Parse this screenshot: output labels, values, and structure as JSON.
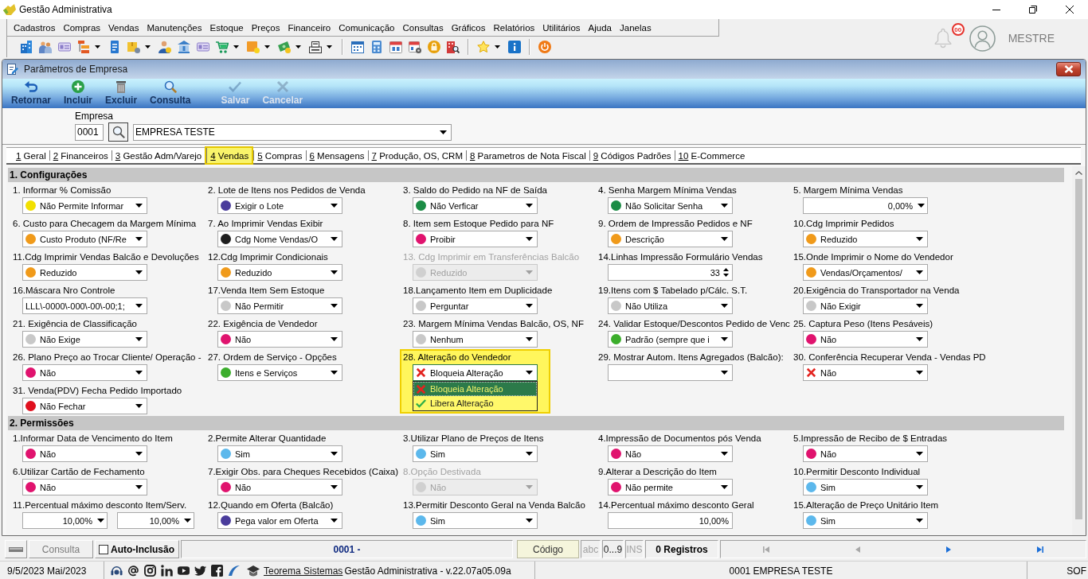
{
  "app": {
    "title": "Gestão Administrativa",
    "notifications": "00",
    "user": "MESTRE"
  },
  "menu": [
    "Cadastros",
    "Compras",
    "Vendas",
    "Manutenções",
    "Estoque",
    "Preços",
    "Financeiro",
    "Comunicação",
    "Consultas",
    "Gráficos",
    "Relatórios",
    "Utilitários",
    "Ajuda",
    "Janelas"
  ],
  "window": {
    "title": "Parâmetros de Empresa"
  },
  "actions": [
    {
      "label": "Retornar",
      "disabled": false
    },
    {
      "label": "Incluir",
      "disabled": false
    },
    {
      "label": "Excluir",
      "disabled": false
    },
    {
      "label": "Consulta",
      "disabled": false
    },
    {
      "label": "Salvar",
      "disabled": true
    },
    {
      "label": "Cancelar",
      "disabled": true
    }
  ],
  "company": {
    "label": "Empresa",
    "code": "0001",
    "name": "EMPRESA TESTE"
  },
  "tabs": [
    {
      "key": "1",
      "label": "Geral",
      "selected": false
    },
    {
      "key": "2",
      "label": "Financeiros",
      "selected": false
    },
    {
      "key": "3",
      "label": "Gestão Adm/Varejo",
      "selected": false
    },
    {
      "key": "4",
      "label": "Vendas",
      "selected": true
    },
    {
      "key": "5",
      "label": "Compras",
      "selected": false
    },
    {
      "key": "6",
      "label": "Mensagens",
      "selected": false
    },
    {
      "key": "7",
      "label": "Produção, OS, CRM",
      "selected": false
    },
    {
      "key": "8",
      "label": "Parametros de Nota Fiscal",
      "selected": false
    },
    {
      "key": "9",
      "label": "Códigos Padrões",
      "selected": false
    },
    {
      "key": "10",
      "label": "E-Commerce",
      "selected": false
    }
  ],
  "sections": [
    {
      "title": "1. Configurações",
      "items": [
        {
          "label": "1. Informar % Comissão",
          "kind": "combo",
          "value": "Não Permite Informar",
          "color": "#f2e000",
          "disabled": false,
          "expanded": false
        },
        {
          "label": "2. Lote de Itens nos Pedidos de Venda",
          "kind": "combo",
          "value": "Exigir o Lote",
          "color": "#4a3c9c",
          "disabled": false,
          "expanded": false
        },
        {
          "label": "3. Saldo do Pedido na NF de Saída",
          "kind": "combo",
          "value": "Não Verficar",
          "color": "#1b8c45",
          "disabled": false,
          "expanded": false
        },
        {
          "label": "4. Senha Margem Mínima Vendas",
          "kind": "combo",
          "value": "Não Solicitar Senha",
          "color": "#1b8c45",
          "disabled": false,
          "expanded": false
        },
        {
          "label": "5. Margem Mínima Vendas",
          "kind": "percent",
          "value": "0,00%",
          "disabled": false,
          "expanded": false
        },
        {
          "label": "6. Custo para Checagem da Margem Mínima",
          "kind": "combo",
          "value": "Custo Produto (NF/Re",
          "color": "#f09a1a",
          "disabled": false,
          "expanded": false
        },
        {
          "label": "7. Ao Imprimir Vendas Exibir",
          "kind": "combo",
          "value": "Cdg Nome Vendas/O",
          "color": "#1e1e1e",
          "disabled": false,
          "expanded": false
        },
        {
          "label": "8. Item sem Estoque Pedido para NF",
          "kind": "combo",
          "value": "Proibir",
          "color": "#e0136e",
          "disabled": false,
          "expanded": false
        },
        {
          "label": "9. Ordem de Impressão Pedidos e NF",
          "kind": "combo",
          "value": "Descrição",
          "color": "#f09a1a",
          "disabled": false,
          "expanded": false
        },
        {
          "label": "10.Cdg Imprimir Pedidos",
          "kind": "combo",
          "value": "Reduzido",
          "color": "#f09a1a",
          "disabled": false,
          "expanded": false
        },
        {
          "label": "11.Cdg Imprimir Vendas Balcão e Devoluções",
          "kind": "combo",
          "value": "Reduzido",
          "color": "#f09a1a",
          "disabled": false,
          "expanded": false
        },
        {
          "label": "12.Cdg Imprimir Condicionais",
          "kind": "combo",
          "value": "Reduzido",
          "color": "#f09a1a",
          "disabled": false,
          "expanded": false
        },
        {
          "label": "13. Cdg Imprimir em Transferências Balcão",
          "kind": "combo",
          "value": "Reduzido",
          "color": "#d0d0d0",
          "disabled": true,
          "expanded": false
        },
        {
          "label": "14.Linhas Impressão Formulário Vendas",
          "kind": "spin",
          "value": "33",
          "disabled": false,
          "expanded": false
        },
        {
          "label": "15.Onde Imprimir o Nome do Vendedor",
          "kind": "combo",
          "value": "Vendas/Orçamentos/",
          "color": "#f09a1a",
          "disabled": false,
          "expanded": false
        },
        {
          "label": "16.Máscara Nro Controle",
          "kind": "mask",
          "value": "LLL\\-0000\\-000\\-00\\-00;1;",
          "disabled": false,
          "expanded": false
        },
        {
          "label": "17.Venda Item Sem Estoque",
          "kind": "combo",
          "value": "Não Permitir",
          "color": "#c8c8c8",
          "disabled": false,
          "expanded": false
        },
        {
          "label": "18.Lançamento Item em Duplicidade",
          "kind": "combo",
          "value": "Perguntar",
          "color": "#c8c8c8",
          "disabled": false,
          "expanded": false
        },
        {
          "label": "19.Itens com $ Tabelado p/Cálc. S.T.",
          "kind": "combo",
          "value": "Não Utiliza",
          "color": "#c8c8c8",
          "disabled": false,
          "expanded": false
        },
        {
          "label": "20.Exigência do Transportador na Venda",
          "kind": "combo",
          "value": "Não Exigir",
          "color": "#c8c8c8",
          "disabled": false,
          "expanded": false
        },
        {
          "label": "21. Exigência de Classificação",
          "kind": "combo",
          "value": "Não Exige",
          "color": "#c8c8c8",
          "disabled": false,
          "expanded": false
        },
        {
          "label": "22. Exigência de Vendedor",
          "kind": "combo",
          "value": "Não",
          "color": "#e0136e",
          "disabled": false,
          "expanded": false
        },
        {
          "label": "23. Margem Mínima Vendas Balcão, OS, NF",
          "kind": "combo",
          "value": "Nenhum",
          "color": "#c8c8c8",
          "disabled": false,
          "expanded": false
        },
        {
          "label": "24. Validar Estoque/Descontos Pedido de Venc",
          "kind": "combo",
          "value": "Padrão (sempre que i",
          "color": "#3cae2c",
          "disabled": false,
          "expanded": false
        },
        {
          "label": "25. Captura Peso (Itens Pesáveis)",
          "kind": "combo",
          "value": "Não",
          "color": "#e0136e",
          "disabled": false,
          "expanded": false
        },
        {
          "label": "26. Plano Preço ao Trocar Cliente/ Operação -",
          "kind": "combo",
          "value": "Não",
          "color": "#e0136e",
          "disabled": false,
          "expanded": false
        },
        {
          "label": "27. Ordem de Serviço - Opções",
          "kind": "combo",
          "value": "Itens e Serviços",
          "color": "#3cae2c",
          "disabled": false,
          "expanded": false
        },
        {
          "label": "28. Alteração do Vendedor",
          "kind": "choice",
          "value": "Bloqueia Alteração",
          "positive": false,
          "disabled": false,
          "expanded": true,
          "options": [
            {
              "value": "Bloqueia Alteração",
              "positive": false,
              "selected": true
            },
            {
              "value": "Libera Alteração",
              "positive": true,
              "selected": false
            }
          ]
        },
        {
          "label": "29. Mostrar Autom. Itens Agregados (Balcão):",
          "kind": "combo",
          "disabled": false,
          "expanded": false
        },
        {
          "label": "30. Conferência Recuperar Venda - Vendas PD",
          "kind": "choice",
          "value": "Não",
          "positive": false,
          "disabled": false,
          "expanded": false
        },
        {
          "label": "31. Venda(PDV) Fecha Pedido Importado",
          "kind": "combo",
          "value": "Não Fechar",
          "color": "#e0101e",
          "disabled": false,
          "expanded": false
        }
      ]
    },
    {
      "title": "2. Permissões",
      "items": [
        {
          "label": "1.Informar Data de Vencimento do Item",
          "kind": "combo",
          "value": "Não",
          "color": "#e0136e",
          "disabled": false,
          "expanded": false
        },
        {
          "label": "2.Permite Alterar Quantidade",
          "kind": "combo",
          "value": "Sim",
          "color": "#5cb8ec",
          "disabled": false,
          "expanded": false
        },
        {
          "label": "3.Utilizar Plano de Preços de Itens",
          "kind": "combo",
          "value": "Sim",
          "color": "#5cb8ec",
          "disabled": false,
          "expanded": false
        },
        {
          "label": "4.Impressão de Documentos pós Venda",
          "kind": "combo",
          "value": "Não",
          "color": "#e0136e",
          "disabled": false,
          "expanded": false
        },
        {
          "label": "5.Impressão de Recibo de $ Entradas",
          "kind": "combo",
          "value": "Não",
          "color": "#e0136e",
          "disabled": false,
          "expanded": false
        },
        {
          "label": "6.Utilizar Cartão de Fechamento",
          "kind": "combo",
          "value": "Não",
          "color": "#e0136e",
          "disabled": false,
          "expanded": false
        },
        {
          "label": "7.Exigir Obs. para Cheques Recebidos (Caixa)",
          "kind": "combo",
          "value": "Não",
          "color": "#e0136e",
          "disabled": false,
          "expanded": false
        },
        {
          "label": "8.Opção Destivada",
          "kind": "combo",
          "value": "Não",
          "color": "#d0d0d0",
          "disabled": true,
          "expanded": false
        },
        {
          "label": "9.Alterar a Descrição do Item",
          "kind": "combo",
          "value": "Não permite",
          "color": "#e0136e",
          "disabled": false,
          "expanded": false
        },
        {
          "label": "10.Permitir Desconto Individual",
          "kind": "combo",
          "value": "Sim",
          "color": "#5cb8ec",
          "disabled": false,
          "expanded": false
        },
        {
          "label": "11.Percentual máximo desconto Item/Serv.",
          "kind": "percent-pair",
          "values": [
            "10,00%",
            "10,00%"
          ],
          "disabled": false,
          "expanded": false
        },
        {
          "label": "12.Quando em Oferta (Balcão)",
          "kind": "combo",
          "value": "Pega valor em Oferta",
          "color": "#4a3c9c",
          "disabled": false,
          "expanded": false
        },
        {
          "label": "13.Permitir Desconto Geral na Venda Balcão",
          "kind": "combo",
          "value": "Sim",
          "color": "#5cb8ec",
          "disabled": false,
          "expanded": false
        },
        {
          "label": "14.Percentual máximo desconto Geral",
          "kind": "field",
          "value": "10,00%",
          "disabled": false,
          "expanded": false
        },
        {
          "label": "15.Alteração de Preço Unitário Item",
          "kind": "combo",
          "value": "Sim",
          "color": "#5cb8ec",
          "disabled": false,
          "expanded": false
        }
      ]
    }
  ],
  "navigator": {
    "mode": "Consulta",
    "auto_include": {
      "label": "Auto-Inclusão",
      "checked": false
    },
    "record": "0001 -",
    "sort_field": "Código",
    "indicators": [
      {
        "text": "abc",
        "on": false
      },
      {
        "text": "0...9",
        "on": true
      },
      {
        "text": "INS",
        "on": false
      }
    ],
    "count": "0 Registros",
    "buttons": [
      {
        "disabled": true
      },
      {
        "disabled": true
      },
      {
        "disabled": false
      },
      {
        "disabled": false
      }
    ]
  },
  "status_bar": {
    "date": "9/5/2023 Mai/2023",
    "link": "Teorema Sistemas",
    "version": "Gestão Administrativa - v.22.07a05.09a",
    "company": "0001 EMPRESA TESTE",
    "panel_4": "SOF"
  }
}
